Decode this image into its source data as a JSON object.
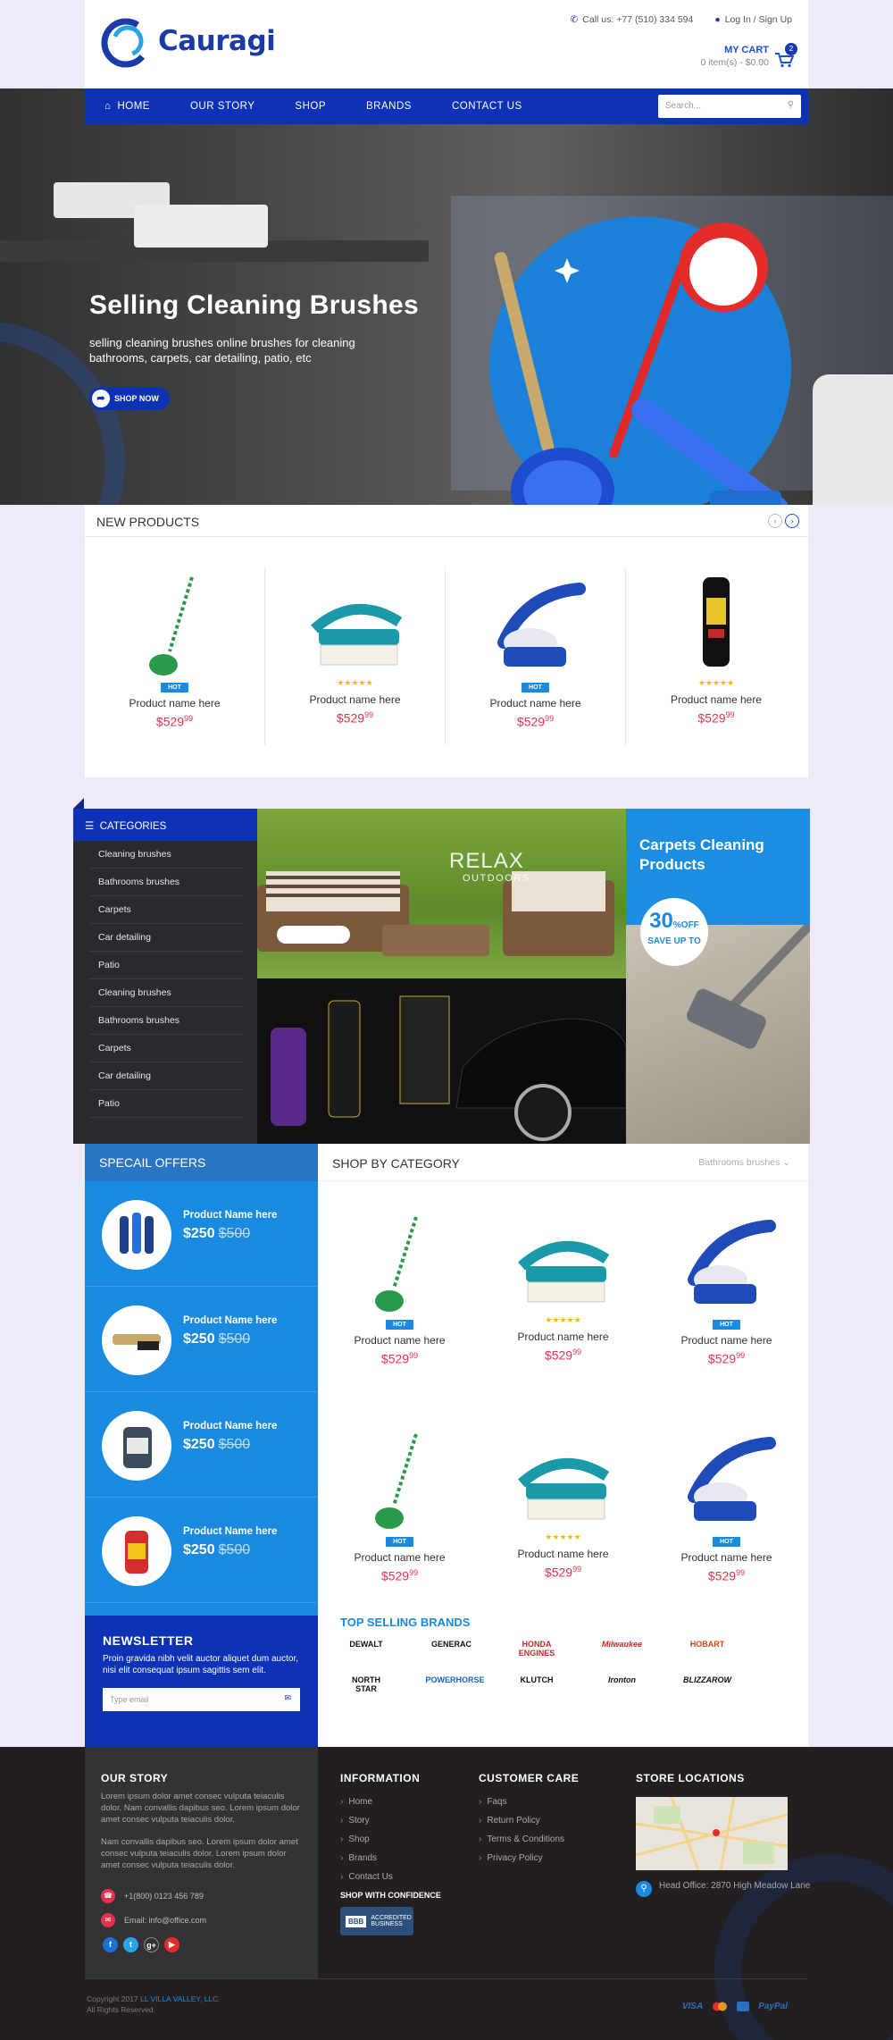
{
  "header": {
    "logo_text": "Cauragi",
    "phone": "Call us: +77 (510) 334 594",
    "login": "Log In / Sign Up",
    "cart_title": "MY CART",
    "cart_summary": "0 item(s) - $0.00",
    "cart_count": "2"
  },
  "nav": {
    "items": [
      "HOME",
      "OUR STORY",
      "SHOP",
      "BRANDS",
      "CONTACT US"
    ],
    "search_placeholder": "Search..."
  },
  "hero": {
    "title": "Selling Cleaning Brushes",
    "subtitle": "selling cleaning brushes online brushes for cleaning bathrooms, carpets, car detailing, patio, etc",
    "button": "SHOP NOW"
  },
  "new_products": {
    "title": "NEW PRODUCTS",
    "items": [
      {
        "tag": "HOT",
        "stars": "",
        "name": "Product name here",
        "price": "$529",
        "cents": "99"
      },
      {
        "tag": "",
        "stars": "★★★★★",
        "name": "Product name here",
        "price": "$529",
        "cents": "99"
      },
      {
        "tag": "HOT",
        "stars": "",
        "name": "Product name here",
        "price": "$529",
        "cents": "99"
      },
      {
        "tag": "",
        "stars": "★★★★★",
        "name": "Product name here",
        "price": "$529",
        "cents": "99"
      }
    ]
  },
  "categories": {
    "title": "CATEGORIES",
    "items": [
      "Cleaning brushes",
      "Bathrooms brushes",
      "Carpets",
      "Car detailing",
      "Patio",
      "Cleaning brushes",
      "Bathrooms brushes",
      "Carpets",
      "Car detailing",
      "Patio"
    ]
  },
  "banners": {
    "relax_title": "RELAX",
    "relax_sub": "OUTDOORS",
    "carpets_title": "Carpets Cleaning Products",
    "discount_value": "30",
    "discount_unit": "%",
    "discount_off": "OFF",
    "discount_text": "SAVE UP TO"
  },
  "special_offers": {
    "title": "SPECAIL OFFERS",
    "items": [
      {
        "name": "Product Name here",
        "price": "$250",
        "old_price": "$500"
      },
      {
        "name": "Product Name here",
        "price": "$250",
        "old_price": "$500"
      },
      {
        "name": "Product Name here",
        "price": "$250",
        "old_price": "$500"
      },
      {
        "name": "Product Name here",
        "price": "$250",
        "old_price": "$500"
      }
    ]
  },
  "newsletter": {
    "title": "NEWSLETTER",
    "text": "Proin gravida nibh velit auctor aliquet dum auctor, nisi elit consequat ipsum sagittis sem elit.",
    "placeholder": "Type email"
  },
  "shop_by_category": {
    "title": "SHOP BY CATEGORY",
    "selected": "Bathrooms brushes",
    "items": [
      {
        "tag": "HOT",
        "stars": "",
        "name": "Product name here",
        "price": "$529",
        "cents": "99"
      },
      {
        "tag": "",
        "stars": "★★★★★",
        "name": "Product name here",
        "price": "$529",
        "cents": "99"
      },
      {
        "tag": "HOT",
        "stars": "",
        "name": "Product name here",
        "price": "$529",
        "cents": "99"
      },
      {
        "tag": "HOT",
        "stars": "",
        "name": "Product name here",
        "price": "$529",
        "cents": "99"
      },
      {
        "tag": "",
        "stars": "★★★★★",
        "name": "Product name here",
        "price": "$529",
        "cents": "99"
      },
      {
        "tag": "HOT",
        "stars": "",
        "name": "Product name here",
        "price": "$529",
        "cents": "99"
      }
    ]
  },
  "brands": {
    "title": "TOP SELLING BRANDS",
    "items": [
      "DEWALT",
      "GENERAC",
      "HONDA ENGINES",
      "Milwaukee",
      "HOBART",
      "NORTH STAR",
      "POWERHORSE",
      "KLUTCH",
      "Ironton",
      "BLIZZAROW"
    ],
    "colors": [
      "#111111",
      "#111111",
      "#c62828",
      "#c62828",
      "#d84315",
      "#111111",
      "#1565c0",
      "#111111",
      "#111111",
      "#111111"
    ]
  },
  "footer": {
    "story_title": "OUR STORY",
    "story_p1": "Lorem ipsum dolor amet consec vulputa teiaculis dolor. Nam convallis dapibus seo. Lorem ipsum dolor amet consec vulputa teiaculis dolor.",
    "story_p2": "Nam convallis dapibus seo. Lorem ipsum dolor amet consec vulputa teiaculis dolor. Lorem ipsum dolor amet consec vulputa teiaculis dolor.",
    "phone": "+1(800) 0123 456 789",
    "email": "Email: info@office.com",
    "info_title": "INFORMATION",
    "info_items": [
      "Home",
      "Story",
      "Shop",
      "Brands",
      "Contact Us"
    ],
    "care_title": "CUSTOMER CARE",
    "care_items": [
      "Faqs",
      "Return Policy",
      "Terms & Conditions",
      "Privacy Policy"
    ],
    "confidence": "SHOP WITH CONFIDENCE",
    "bbb_label": "BBB",
    "bbb_text": "ACCREDITED BUSINESS",
    "store_title": "STORE LOCATIONS",
    "office": "Head Office: 2870 High Meadow Lane",
    "copyright_prefix": "Copyright 2017 ",
    "copyright_company": "LL VILLA VALLEY, LLC.",
    "rights": "All Rights Reserved.",
    "payments": [
      "VISA",
      "PayPal"
    ]
  }
}
